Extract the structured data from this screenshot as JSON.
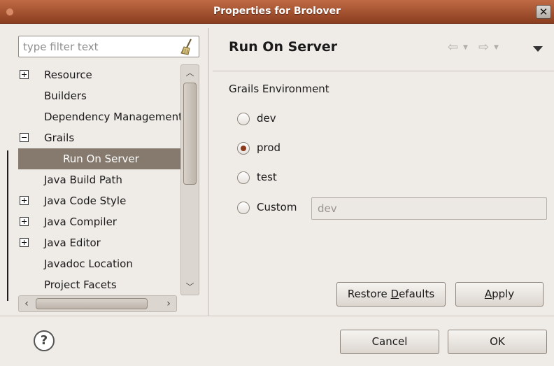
{
  "window": {
    "title": "Properties for Brolover",
    "close_glyph": "✕"
  },
  "filter": {
    "placeholder": "type filter text"
  },
  "tree": {
    "items": [
      {
        "label": "Resource",
        "expander": "plus"
      },
      {
        "label": "Builders",
        "expander": "none"
      },
      {
        "label": "Dependency Management",
        "expander": "none"
      },
      {
        "label": "Grails",
        "expander": "minus"
      },
      {
        "label": "Run On Server",
        "expander": "none",
        "selected": true,
        "child": true
      },
      {
        "label": "Java Build Path",
        "expander": "none"
      },
      {
        "label": "Java Code Style",
        "expander": "plus"
      },
      {
        "label": "Java Compiler",
        "expander": "plus"
      },
      {
        "label": "Java Editor",
        "expander": "plus"
      },
      {
        "label": "Javadoc Location",
        "expander": "none"
      },
      {
        "label": "Project Facets",
        "expander": "none"
      }
    ]
  },
  "page": {
    "title": "Run On Server",
    "group_label": "Grails Environment",
    "radios": [
      {
        "label": "dev",
        "checked": false
      },
      {
        "label": "prod",
        "checked": true
      },
      {
        "label": "test",
        "checked": false
      },
      {
        "label": "Custom",
        "checked": false
      }
    ],
    "custom_value": "dev"
  },
  "buttons": {
    "restore_pre": "Restore ",
    "restore_mn": "D",
    "restore_post": "efaults",
    "apply_mn": "A",
    "apply_post": "pply",
    "cancel": "Cancel",
    "ok": "OK",
    "help": "?"
  }
}
